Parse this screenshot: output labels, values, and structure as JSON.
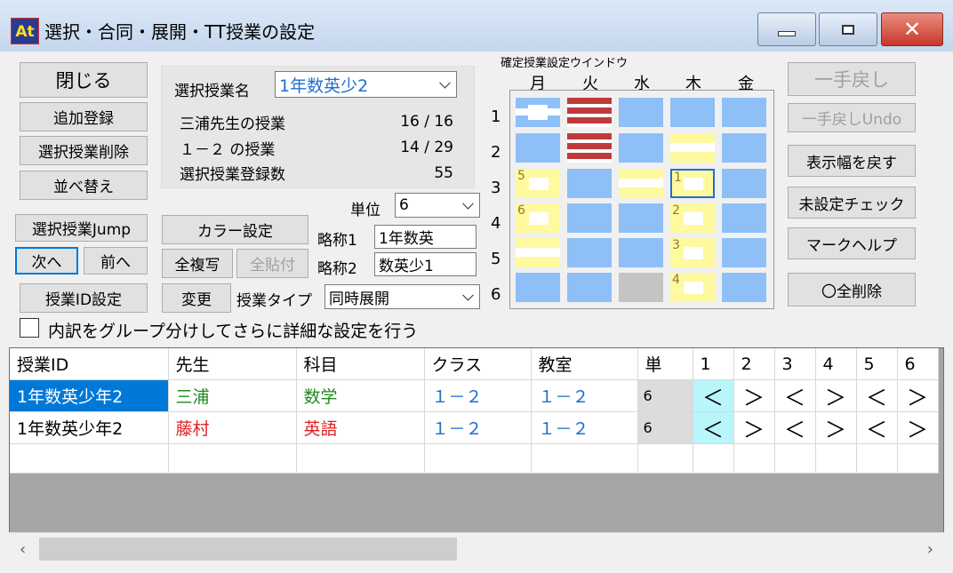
{
  "window": {
    "title": "選択・合同・展開・TT授業の設定",
    "app_icon_text": "At"
  },
  "left_buttons": {
    "close": "閉じる",
    "add": "追加登録",
    "delete": "選択授業削除",
    "sort": "並べ替え",
    "jump": "選択授業Jump",
    "next": "次へ",
    "prev": "前へ",
    "id_setting": "授業ID設定"
  },
  "info": {
    "select_label": "選択授業名",
    "select_value": "1年数英少2",
    "teacher_label": "三浦先生の授業",
    "teacher_count": "16 / 16",
    "class_label": "１－２ の授業",
    "class_count": "14 / 29",
    "reg_label": "選択授業登録数",
    "reg_count": "55"
  },
  "mid_controls": {
    "unit_label": "単位",
    "unit_value": "6",
    "color_button": "カラー設定",
    "copy_all": "全複写",
    "paste_all": "全貼付",
    "change": "変更",
    "abbr1_label": "略称1",
    "abbr1_value": "1年数英",
    "abbr2_label": "略称2",
    "abbr2_value": "数英少1",
    "type_label": "授業タイプ",
    "type_value": "同時展開"
  },
  "schedule": {
    "title": "確定授業設定ウインドウ",
    "days": [
      "月",
      "火",
      "水",
      "木",
      "金"
    ],
    "periods": [
      "1",
      "2",
      "3",
      "4",
      "5",
      "6"
    ],
    "marks": {
      "m3": "5",
      "m4": "6",
      "t3": "1",
      "t4": "2",
      "t5": "3",
      "t6": "4"
    }
  },
  "right_buttons": {
    "undo": "一手戻し",
    "undo_redo": "一手戻しUndo",
    "restore_width": "表示幅を戻す",
    "unset_check": "未設定チェック",
    "mark_help": "マークヘルプ",
    "delete_all": "〇全削除"
  },
  "group_checkbox_label": "内訳をグループ分けしてさらに詳細な設定を行う",
  "table": {
    "headers": [
      "授業ID",
      "先生",
      "科目",
      "クラス",
      "教室",
      "単",
      "1",
      "2",
      "3",
      "4",
      "5",
      "6"
    ],
    "rows": [
      {
        "id": "1年数英少年2",
        "teacher": "三浦",
        "subject": "数学",
        "klass": "１－２",
        "room": "１－２",
        "unit": "6",
        "marks": [
          "＜",
          "＞",
          "＜",
          "＞",
          "＜",
          "＞"
        ]
      },
      {
        "id": "1年数英少年2",
        "teacher": "藤村",
        "subject": "英語",
        "klass": "１－２",
        "room": "１－２",
        "unit": "6",
        "marks": [
          "＜",
          "＞",
          "＜",
          "＞",
          "＜",
          "＞"
        ]
      }
    ]
  },
  "scrollbar": {
    "left_arrow": "‹",
    "right_arrow": "›"
  },
  "colors": {
    "cell_blue": "#8ec0f7",
    "cell_yellow": "#fff9a0",
    "cell_red": "#bf3a3a",
    "cell_gray": "#c4c4c4",
    "selection": "#0078d7",
    "teacher_green": "#1c8a1c",
    "teacher_red": "#e02020"
  }
}
